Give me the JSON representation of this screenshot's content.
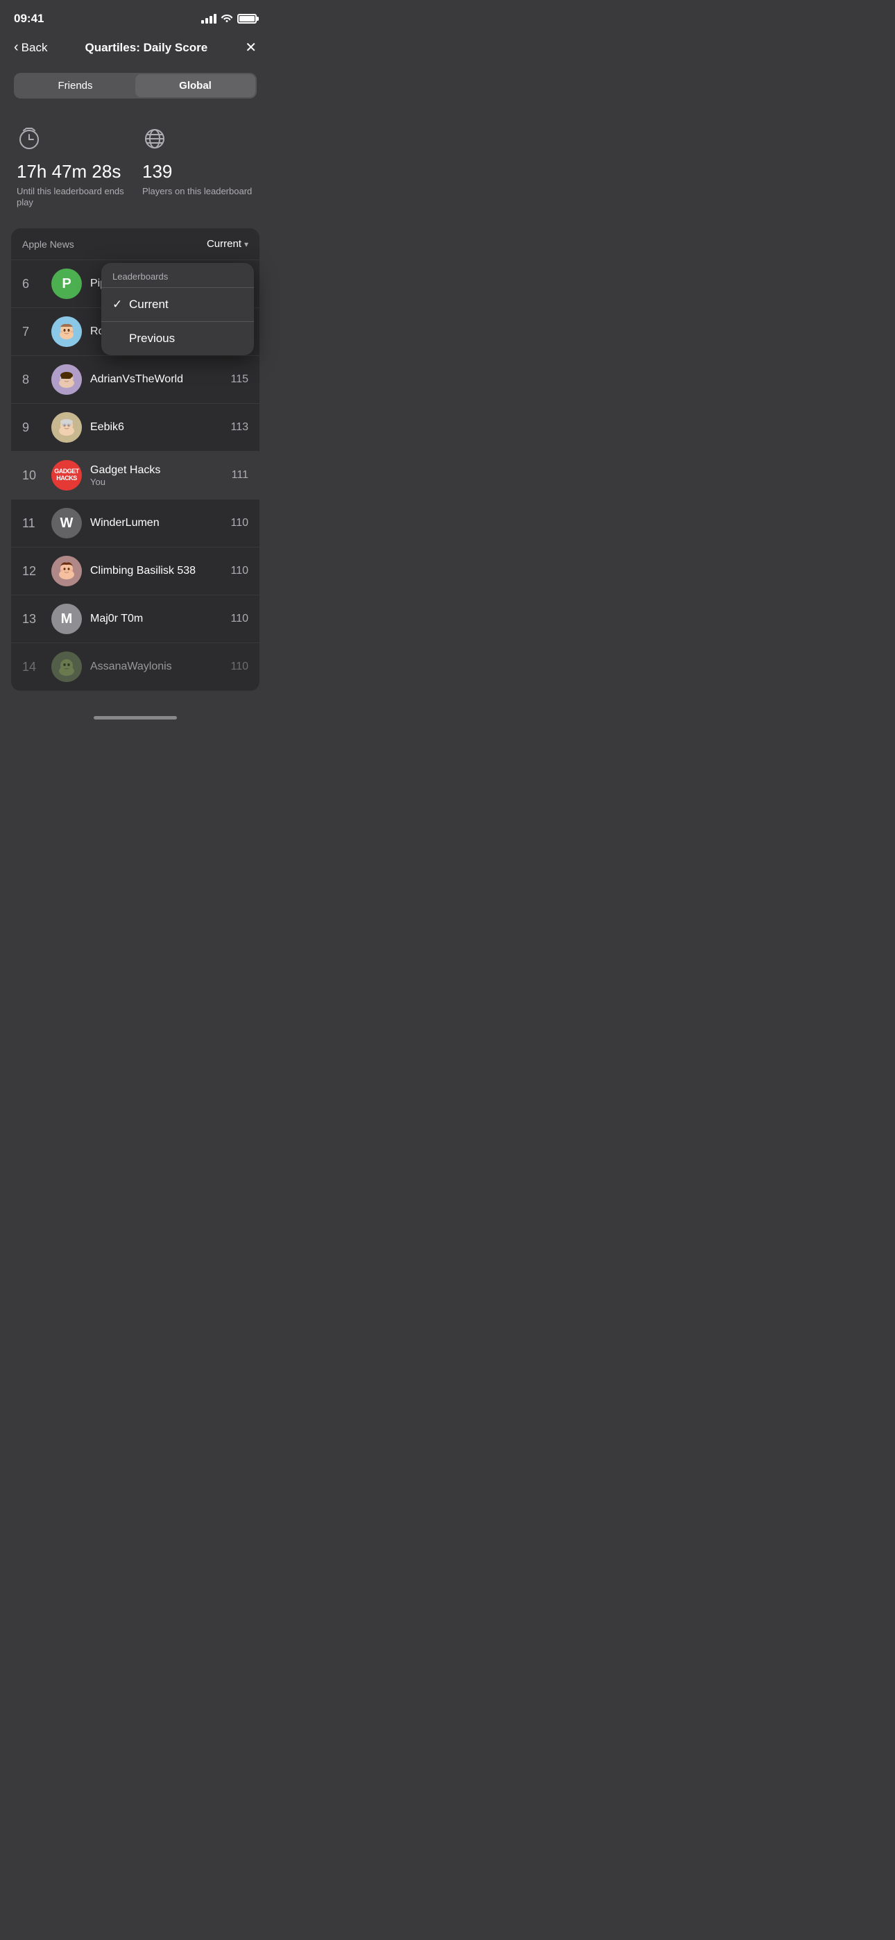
{
  "statusBar": {
    "time": "09:41",
    "battery": 100
  },
  "nav": {
    "backLabel": "Back",
    "title": "Quartiles: Daily Score",
    "closeLabel": "✕"
  },
  "segments": {
    "options": [
      "Friends",
      "Global"
    ],
    "active": "Global"
  },
  "stats": [
    {
      "icon": "⏱",
      "value": "17h 47m 28s",
      "label": "Until this leaderboard ends play"
    },
    {
      "icon": "🌐",
      "value": "139",
      "label": "Players on this leaderboard"
    }
  ],
  "leaderboard": {
    "source": "Apple News",
    "filter": "Current",
    "dropdown": {
      "header": "Leaderboards",
      "options": [
        {
          "label": "Current",
          "selected": true
        },
        {
          "label": "Previous",
          "selected": false
        }
      ]
    },
    "players": [
      {
        "rank": 6,
        "name": "PipeD",
        "score": null,
        "avatarType": "letter",
        "avatarBg": "avatar-green",
        "avatarLetter": "P",
        "isYou": false,
        "faded": false
      },
      {
        "rank": 7,
        "name": "Rossv",
        "score": null,
        "avatarType": "memoji-male",
        "avatarBg": "avatar-blue-memoji",
        "isYou": false,
        "faded": false
      },
      {
        "rank": 8,
        "name": "AdrianVsTheWorld",
        "score": "115",
        "avatarType": "memoji-spy",
        "avatarBg": "avatar-purple-memoji",
        "isYou": false,
        "faded": false
      },
      {
        "rank": 9,
        "name": "Eebik6",
        "score": "113",
        "avatarType": "memoji-grandma",
        "avatarBg": "avatar-teal-memoji",
        "isYou": false,
        "faded": false
      },
      {
        "rank": 10,
        "name": "Gadget Hacks",
        "subLabel": "You",
        "score": "111",
        "avatarType": "brand-red",
        "avatarBg": "avatar-red",
        "avatarText": "GADGET\nHACKS",
        "isYou": true,
        "highlighted": true,
        "faded": false
      },
      {
        "rank": 11,
        "name": "WinderLumen",
        "score": "110",
        "avatarType": "letter",
        "avatarBg": "avatar-lightgray",
        "avatarLetter": "W",
        "isYou": false,
        "faded": false
      },
      {
        "rank": 12,
        "name": "Climbing Basilisk 538",
        "score": "110",
        "avatarType": "memoji-woman",
        "avatarBg": "avatar-teal-memoji",
        "isYou": false,
        "faded": false
      },
      {
        "rank": 13,
        "name": "Maj0r T0m",
        "score": "110",
        "avatarType": "letter",
        "avatarBg": "avatar-m-gray",
        "avatarLetter": "M",
        "isYou": false,
        "faded": false
      },
      {
        "rank": 14,
        "name": "AssanaWaylonis",
        "score": "110",
        "avatarType": "memoji-creature",
        "avatarBg": "avatar-green-memoji",
        "isYou": false,
        "faded": true
      }
    ]
  }
}
